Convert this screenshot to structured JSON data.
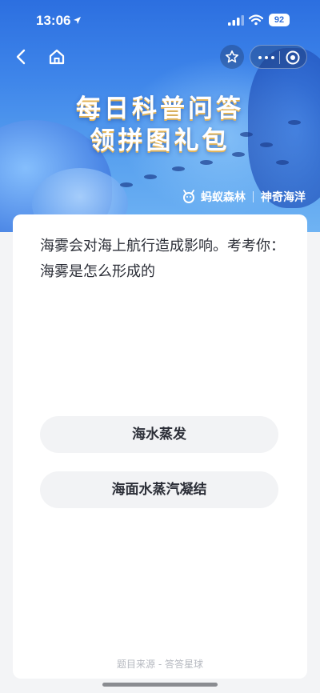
{
  "status_bar": {
    "time": "13:06",
    "battery": "92"
  },
  "banner": {
    "title_line1": "每日科普问答",
    "title_line2": "领拼图礼包",
    "brand_left": "蚂蚁森林",
    "brand_right": "神奇海洋"
  },
  "quiz": {
    "question": "海雾会对海上航行造成影响。考考你：海雾是怎么形成的",
    "options": [
      {
        "label": "海水蒸发"
      },
      {
        "label": "海面水蒸汽凝结"
      }
    ],
    "source": "题目来源 - 答答星球"
  },
  "icons": {
    "back": "chevron-left-icon",
    "home": "home-icon",
    "star": "star-icon",
    "more": "more-dots-icon",
    "close": "target-circle-icon"
  }
}
